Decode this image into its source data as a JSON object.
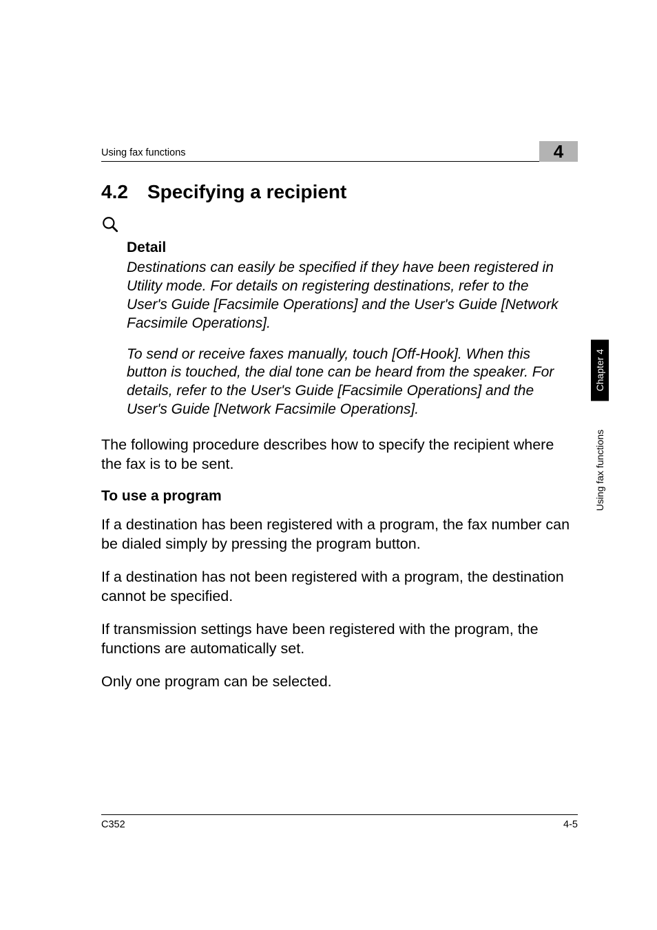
{
  "header": {
    "section_label": "Using fax functions",
    "chapter_number": "4"
  },
  "heading": {
    "number": "4.2",
    "title": "Specifying a recipient"
  },
  "detail": {
    "label": "Detail",
    "para1": "Destinations can easily be specified if they have been registered in Utility mode. For details on registering destinations, refer to the User's Guide [Facsimile Operations] and the User's Guide [Network Facsimile Operations].",
    "para2": "To send or receive faxes manually, touch [Off-Hook]. When this button is touched, the dial tone can be heard from the speaker. For details, refer to the User's Guide [Facsimile Operations] and the User's Guide [Network Facsimile Operations]."
  },
  "intro": "The following procedure describes how to specify the recipient where the fax is to be sent.",
  "subheading": "To use a program",
  "body": {
    "p1": "If a destination has been registered with a program, the fax number can be dialed simply by pressing the program button.",
    "p2": "If a destination has not been registered with a program, the destination cannot be specified.",
    "p3": "If transmission settings have been registered with the program, the functions are automatically set.",
    "p4": "Only one program can be selected."
  },
  "sidetabs": {
    "chapter": "Chapter 4",
    "section": "Using fax functions"
  },
  "footer": {
    "model": "C352",
    "page": "4-5"
  }
}
